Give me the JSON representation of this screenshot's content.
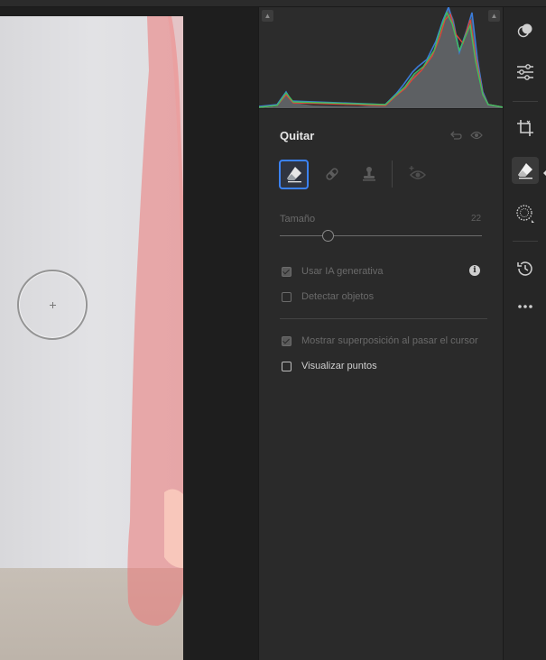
{
  "panel": {
    "title": "Quitar",
    "title_icons": [
      "reset-icon",
      "visibility-eye-icon"
    ],
    "tools": [
      {
        "name": "eraser-remove-tool",
        "active": true
      },
      {
        "name": "heal-bandage-tool",
        "active": false
      },
      {
        "name": "clone-stamp-tool",
        "active": false
      },
      {
        "name": "distraction-removal-tool",
        "active": false
      }
    ],
    "size_slider": {
      "label": "Tamaño",
      "value": "22",
      "level": 0.24
    },
    "options": [
      {
        "label": "Usar IA generativa",
        "checked": true,
        "enabled": false
      },
      {
        "label": "Detectar objetos",
        "checked": false,
        "enabled": false
      }
    ],
    "overlay_options": [
      {
        "label": "Mostrar superposición al pasar el cursor",
        "checked": true,
        "enabled": false
      },
      {
        "label": "Visualizar puntos",
        "checked": false,
        "enabled": true
      }
    ]
  },
  "histogram": {
    "channels": [
      "red",
      "green",
      "blue",
      "luminance"
    ],
    "colors": {
      "red": "#e0453a",
      "green": "#3fbf5f",
      "blue": "#3b7bd8",
      "luminance": "#9aa0a6"
    }
  },
  "toolbar": {
    "items": [
      "presets-icon",
      "edit-sliders-icon",
      "crop-icon",
      "eraser-icon",
      "masking-icon",
      "history-icon",
      "more-icon"
    ],
    "active": "eraser-icon"
  },
  "theme": {
    "accent": "#3b82f6",
    "panel_bg": "#2a2a2a"
  }
}
